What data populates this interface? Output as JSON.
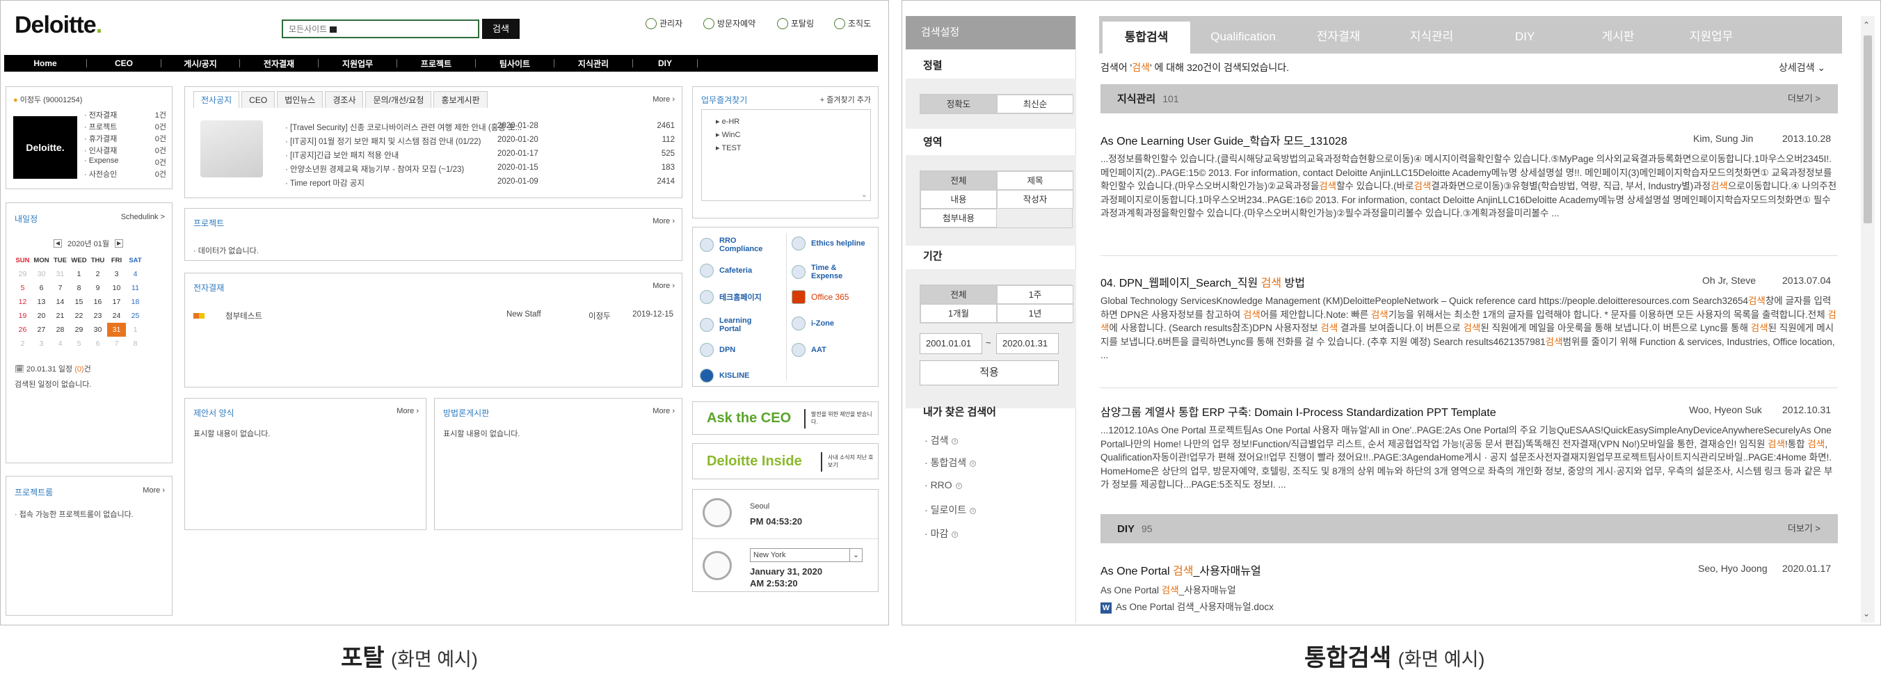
{
  "portal": {
    "logo": "Deloitte",
    "search": {
      "scope": "모든사이트",
      "button": "검색"
    },
    "util": [
      "관리자",
      "방문자예약",
      "포탈링",
      "조직도"
    ],
    "nav": [
      "Home",
      "CEO",
      "게시/공지",
      "전자결재",
      "지원업무",
      "프로젝트",
      "팀사이트",
      "지식관리",
      "DIY"
    ],
    "profile": {
      "name": "이정두 (90001254)",
      "photo_text": "Deloitte.",
      "items": [
        [
          "전자결재",
          "1건"
        ],
        [
          "프로젝트",
          "0건"
        ],
        [
          "휴가결재",
          "0건"
        ],
        [
          "인사결재",
          "0건"
        ],
        [
          "Expense",
          "0건"
        ],
        [
          "사전승인",
          "0건"
        ]
      ]
    },
    "schedule": {
      "title": "내일정",
      "link": "Schedulink >",
      "month": "2020년 01월",
      "weekdays": [
        "SUN",
        "MON",
        "TUE",
        "WED",
        "THU",
        "FRI",
        "SAT"
      ],
      "weeks": [
        [
          "29",
          "30",
          "31",
          "1",
          "2",
          "3",
          "4"
        ],
        [
          "5",
          "6",
          "7",
          "8",
          "9",
          "10",
          "11"
        ],
        [
          "12",
          "13",
          "14",
          "15",
          "16",
          "17",
          "18"
        ],
        [
          "19",
          "20",
          "21",
          "22",
          "23",
          "24",
          "25"
        ],
        [
          "26",
          "27",
          "28",
          "29",
          "30",
          "31",
          "1"
        ],
        [
          "2",
          "3",
          "4",
          "5",
          "6",
          "7",
          "8"
        ]
      ],
      "date_line": "20.01.31 일정 ",
      "count": "(0)",
      "count_suffix": "건",
      "empty": "검색된 일정이 없습니다."
    },
    "project_room": {
      "title": "프로젝트룸",
      "more": "More",
      "empty": "접속 가능한 프로젝트룸이 없습니다."
    },
    "notice": {
      "tabs": [
        "전사공지",
        "CEO",
        "법인뉴스",
        "경조사",
        "문의/개선/요청",
        "홍보게시판"
      ],
      "more": "More",
      "rows": [
        [
          "[Travel Security] 신종 코로나바이러스 관련 여행 제한 안내 (홍콩 포...",
          "2020-01-28",
          "2461"
        ],
        [
          "[IT공지] 01월 정기 보안 패치 및 시스템 점검 안내 (01/22)",
          "2020-01-20",
          "112"
        ],
        [
          "[IT공지]긴급 보안 패치 적용 안내",
          "2020-01-17",
          "525"
        ],
        [
          "안양소년원 경제교육 재능기부 - 참여자 모집 (~1/23)",
          "2020-01-15",
          "183"
        ],
        [
          "Time report 마감 공지",
          "2020-01-09",
          "2414"
        ]
      ]
    },
    "project": {
      "title": "프로젝트",
      "more": "More",
      "empty": "데이터가 없습니다."
    },
    "approval": {
      "title": "전자결재",
      "more": "More",
      "row": [
        "첨부테스트",
        "New Staff",
        "이정두",
        "2019-12-15"
      ]
    },
    "proposal": {
      "title": "제안서 양식",
      "more": "More",
      "empty": "표시할 내용이 없습니다."
    },
    "board": {
      "title": "방법론게시판",
      "more": "More",
      "empty": "표시할 내용이 없습니다."
    },
    "favorites": {
      "title": "업무즐겨찾기",
      "add": "+ 즐겨찾기 추가",
      "items": [
        "e-HR",
        "WinC",
        "TEST"
      ]
    },
    "links": [
      [
        "RRO Compliance",
        "Ethics helpline"
      ],
      [
        "Cafeteria",
        "Time & Expense"
      ],
      [
        "테크홈페이지",
        "Office 365"
      ],
      [
        "Learning Portal",
        "i-Zone"
      ],
      [
        "DPN",
        "AAT"
      ],
      [
        "KISLINE",
        ""
      ]
    ],
    "ask_ceo": {
      "title": "Ask the CEO",
      "sub": "발전을 위한 제안을 받습니다."
    },
    "inside": {
      "title": "Deloitte Inside",
      "sub": "사내 소식지 지난 호 보기"
    },
    "clock1": {
      "city": "Seoul",
      "time": "PM 04:53:20"
    },
    "clock2": {
      "city": "New York",
      "date": "January 31, 2020",
      "time": "AM 2:53:20"
    },
    "caption": {
      "main": "포탈",
      "sub": "(화면 예시)"
    }
  },
  "search": {
    "sidebar": {
      "title": "검색설정",
      "sort": "정렬",
      "sort_opts": [
        "정확도",
        "최신순"
      ],
      "area": "영역",
      "area_opts": [
        "전체",
        "제목",
        "내용",
        "작성자",
        "첨부내용"
      ],
      "period": "기간",
      "period_opts": [
        "전체",
        "1주",
        "1개월",
        "1년"
      ],
      "from": "2001.01.01",
      "tilde": "~",
      "to": "2020.01.31",
      "apply": "적용",
      "recent": "내가 찾은 검색어",
      "recent_items": [
        "검색",
        "통합검색",
        "RRO",
        "딜로이트",
        "마감"
      ]
    },
    "tabs": [
      "통합검색",
      "Qualification",
      "전자결재",
      "지식관리",
      "DIY",
      "게시판",
      "지원업무"
    ],
    "summary": {
      "pre": "검색어 '",
      "kw": "검색",
      "post": "' 에 대해 320건이 검색되었습니다.",
      "detail": "상세검색"
    },
    "sections": [
      {
        "name": "지식관리",
        "count": "101",
        "more": "더보기 >"
      },
      {
        "name": "DIY",
        "count": "95",
        "more": "더보기 >"
      }
    ],
    "results": [
      {
        "title": "As One Learning User Guide_학습자 모드_131028",
        "author": "Kim, Sung Jin",
        "date": "2013.10.28",
        "body": "...정정보를확인할수 있습니다.(클릭시해당교육방법의교육과정학습현황으로이동)④ 메시지이력을확인할수 있습니다.⑤MyPage 의사외교육결과등록화면으로이동합니다.1마우스오버2345I!. 메인페이지(2)..PAGE:15© 2013. For information, contact Deloitte AnjinLLC15Deloitte Academy메뉴명 상세설명설 명!!. 메인페이지(3)메인페이지학습자모드의첫화면① 교육과정정보를확인할수 있습니다.(마우스오버시확인가능)②교육과정을검색할수 있습니다.(바로검색결과화면으로이동)③유형별(학습방법, 역량, 직급, 부서, Industry별)과정검색으로이동합니다.④ 나의주천과정페이지로이동합니다.1마우스오버234..PAGE:16© 2013. For information, contact Deloitte AnjinLLC16Deloitte Academy메뉴명 상세설명설 명메인페이지학습자모드의첫화면① 필수과정과계획과정을확인할수 있습니다.(마우스오버시확인가능)②필수과정을미리볼수 있습니다.③계획과정을미리볼수 ..."
      },
      {
        "title_pre": "04. DPN_웹페이지_Search_직원 ",
        "title_kw": "검색",
        "title_post": " 방법",
        "author": "Oh Jr, Steve",
        "date": "2013.07.04",
        "body": "Global Technology ServicesKnowledge Management (KM)DeloittePeopleNetwork – Quick reference card https://people.deloitteresources.com Search32654검색창에 글자를 입력하면 DPN은 사용자정보를 참고하여 검색어를 제안합니다.Note: 빠른 검색기능을 위해서는 최소한 1개의 글자를 입력해야 합니다. * 문자를 이용하면 모든 사용자의 목록을 출력합니다.전체 검색에 사용합니다. (Search results참조)DPN 사용자정보 검색 결과를 보여줍니다.이 버튼으로 검색된 직원에게 메일을 아웃룩을 통해 보냅니다.이 버튼으로 Lync를 통해 검색된 직원에게 메시지를 보냅니다.6버튼을 클릭하면Lync를 통해 전화를 걸 수 있습니다. (추후 지원 예정) Search results4621357981검색범위를 줄이기 위해 Function & services, Industries, Office location, ..."
      },
      {
        "title": "삼양그룹 계열사 통합 ERP 구축: Domain Ⅰ-Process Standardization PPT Template",
        "author": "Woo, Hyeon Suk",
        "date": "2012.10.31",
        "body": "...12012.10As One Portal 프로젝트팀As One Portal 사용자 매뉴얼'All in One'..PAGE:2As One Portal의 주요 기능QuESAAS!QuickEasySimpleAnyDeviceAnywhereSecurelyAs One Portal나만의 Home! 나만의 업무 정보!Function/직급별업무 리스트, 순서 제공협업작업 가능!(공동 문서 편집)똑똑해진 전자결재(VPN No!)모바일을 통한, 결재승인! 임직원 검색!통합 검색, Qualification자동이관!업무가 편해 졌어요!!업무 진행이 빨라 졌어요!!..PAGE:3AgendaHome게시 · 공지 설문조사전자결재지원업무프로젝트팀사이트지식관리모바일..PAGE:4Home 화면!. HomeHome은 상단의 업무, 방문자예약, 호텔링, 조직도 및 8개의 상위 메뉴와 하단의 3개 영역으로 좌측의 개인화 정보, 중앙의 게시·공지와 업무, 우측의 설문조사, 시스템 링크 등과 같은 부가 정보를 제공합니다...PAGE:5조직도 정보I. ..."
      },
      {
        "title_pre": "As One Portal ",
        "title_kw": "검색",
        "title_post": "_사용자매뉴얼",
        "author": "Seo, Hyo Joong",
        "date": "2020.01.17",
        "line_pre": "As One Portal ",
        "line_kw": "검색",
        "line_post": "_사용자매뉴얼",
        "file": "As One Portal 검색_사용자매뉴얼.docx"
      }
    ],
    "caption": {
      "main": "통합검색",
      "sub": "(화면 예시)"
    }
  }
}
